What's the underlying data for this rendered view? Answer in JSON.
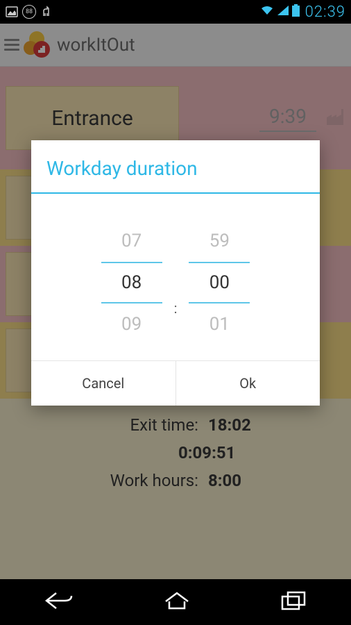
{
  "status": {
    "badge": "88",
    "clock": "02:39"
  },
  "actionbar": {
    "title": "workItOut"
  },
  "background": {
    "entrance_label": "Entrance",
    "entrance_time": "9:39",
    "exit_label": "Exit time:",
    "exit_time": "18:02",
    "timer": "0:09:51",
    "work_hours_label": "Work hours:",
    "work_hours": "8:00"
  },
  "dialog": {
    "title": "Workday duration",
    "hours": {
      "prev": "07",
      "current": "08",
      "next": "09"
    },
    "minutes": {
      "prev": "59",
      "current": "00",
      "next": "01"
    },
    "separator": ":",
    "cancel": "Cancel",
    "ok": "Ok"
  }
}
